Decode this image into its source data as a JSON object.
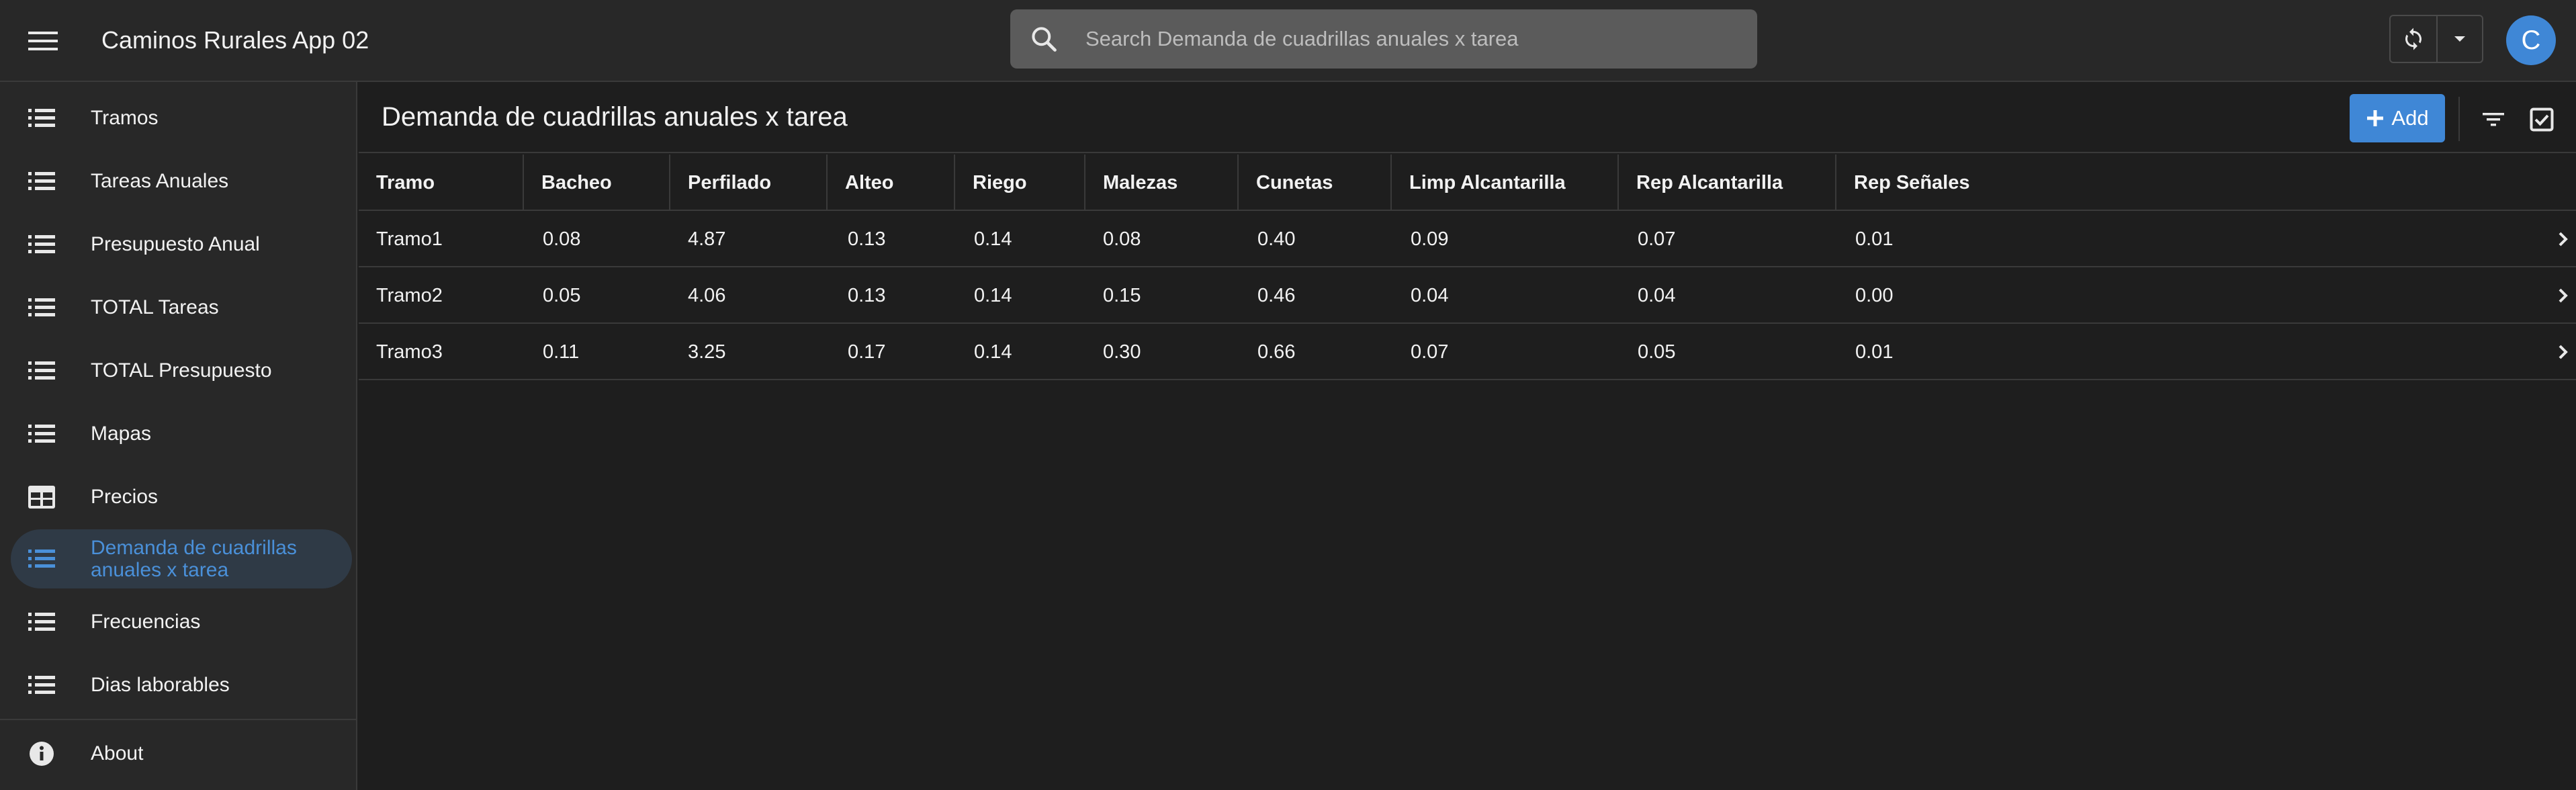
{
  "app": {
    "title": "Caminos Rurales App 02",
    "avatar_letter": "C",
    "accent_color": "#3f87d6"
  },
  "search": {
    "placeholder": "Search Demanda de cuadrillas anuales x tarea",
    "value": ""
  },
  "sidebar": {
    "items": [
      {
        "label": "Tramos",
        "icon": "list-icon"
      },
      {
        "label": "Tareas Anuales",
        "icon": "list-icon"
      },
      {
        "label": "Presupuesto Anual",
        "icon": "list-icon"
      },
      {
        "label": "TOTAL Tareas",
        "icon": "list-icon"
      },
      {
        "label": "TOTAL Presupuesto",
        "icon": "list-icon"
      },
      {
        "label": "Mapas",
        "icon": "list-icon"
      },
      {
        "label": "Precios",
        "icon": "table-icon"
      },
      {
        "label": "Demanda de cuadrillas anuales x tarea",
        "icon": "list-icon",
        "active": true
      },
      {
        "label": "Frecuencias",
        "icon": "list-icon"
      },
      {
        "label": "Dias laborables",
        "icon": "list-icon"
      }
    ],
    "about": {
      "label": "About",
      "icon": "info-icon"
    }
  },
  "main": {
    "title": "Demanda de cuadrillas anuales x tarea",
    "add_label": "Add"
  },
  "table": {
    "columns": [
      "Tramo",
      "Bacheo",
      "Perfilado",
      "Alteo",
      "Riego",
      "Malezas",
      "Cunetas",
      "Limp Alcantarilla",
      "Rep Alcantarilla",
      "Rep Señales"
    ],
    "rows": [
      [
        "Tramo1",
        "0.08",
        "4.87",
        "0.13",
        "0.14",
        "0.08",
        "0.40",
        "0.09",
        "0.07",
        "0.01"
      ],
      [
        "Tramo2",
        "0.05",
        "4.06",
        "0.13",
        "0.14",
        "0.15",
        "0.46",
        "0.04",
        "0.04",
        "0.00"
      ],
      [
        "Tramo3",
        "0.11",
        "3.25",
        "0.17",
        "0.14",
        "0.30",
        "0.66",
        "0.07",
        "0.05",
        "0.01"
      ]
    ]
  }
}
